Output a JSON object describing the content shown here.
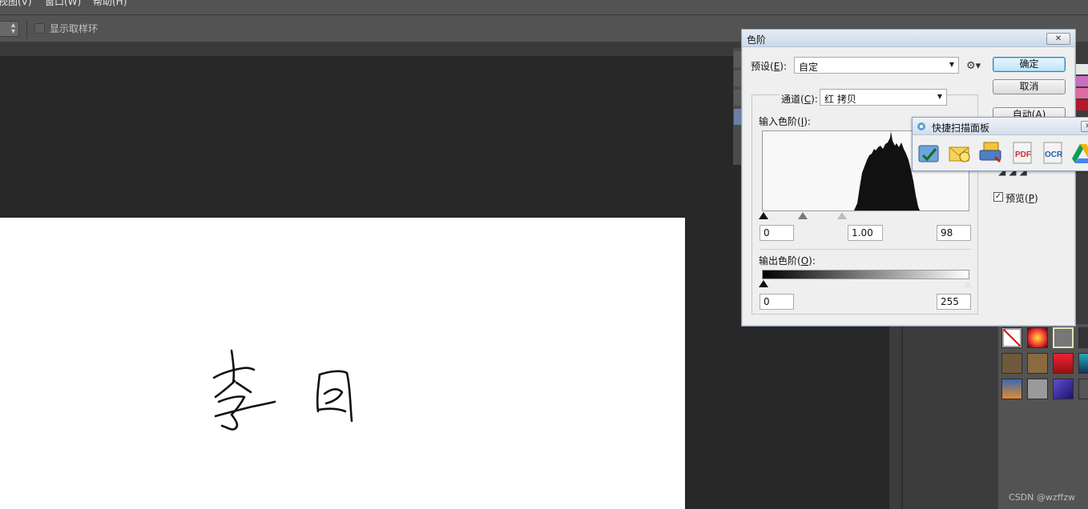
{
  "menubar": {
    "items": [
      "视图(V)",
      "窗口(W)",
      "帮助(H)"
    ]
  },
  "options_bar": {
    "show_sampling_ring": "显示取样环",
    "show_sampling_ring_checked": false
  },
  "levels_dialog": {
    "title": "色阶",
    "close": "✕",
    "preset_label_pre": "预设(",
    "preset_mnemonic": "E",
    "preset_label_post": "):",
    "preset_value": "自定",
    "ok_button": "确定",
    "cancel_button": "取消",
    "auto_button": "自动(A)",
    "channel_label_pre": "通道(",
    "channel_mnemonic": "C",
    "channel_label_post": "):",
    "channel_value": "红 拷贝",
    "input_levels_pre": "输入色阶(",
    "input_levels_mnemonic": "I",
    "input_levels_post": "):",
    "input_black": "0",
    "input_gamma": "1.00",
    "input_white": "98",
    "output_levels_pre": "输出色阶(",
    "output_levels_mnemonic": "O",
    "output_levels_post": "):",
    "output_black": "0",
    "output_white": "255",
    "preview_pre": "预览(",
    "preview_mnemonic": "P",
    "preview_post": ")",
    "preview_checked": true,
    "preview_check_glyph": "✓"
  },
  "scan_panel": {
    "title": "快捷扫描面板",
    "close": "✕",
    "tools": [
      "scan-to-image",
      "scan-to-email",
      "scan-to-printer",
      "PDF",
      "OCR",
      "drive"
    ]
  },
  "watermark": "CSDN @wzffzw",
  "colors": {
    "app_bg": "#282828",
    "panel_gray": "#535353",
    "dialog_bg": "#efefef",
    "default_button_blue": "#bfe4f8"
  }
}
